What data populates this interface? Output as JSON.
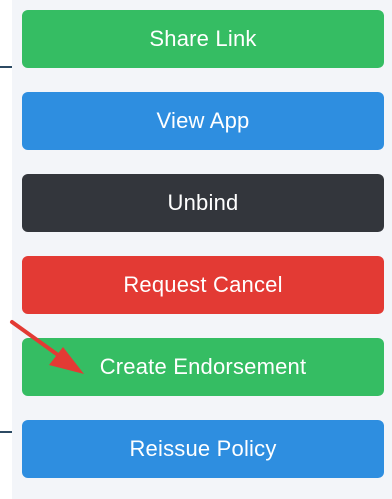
{
  "buttons": [
    {
      "label": "Share Link",
      "color": "#35bd63"
    },
    {
      "label": "View App",
      "color": "#2e8ee0"
    },
    {
      "label": "Unbind",
      "color": "#33363c"
    },
    {
      "label": "Request Cancel",
      "color": "#e33a34"
    },
    {
      "label": "Create Endorsement",
      "color": "#35bd63"
    },
    {
      "label": "Reissue Policy",
      "color": "#2e8ee0"
    }
  ],
  "annotation": {
    "arrow_icon": "red-arrow-icon",
    "arrow_color": "#e33a34",
    "points_to": "Create Endorsement"
  }
}
